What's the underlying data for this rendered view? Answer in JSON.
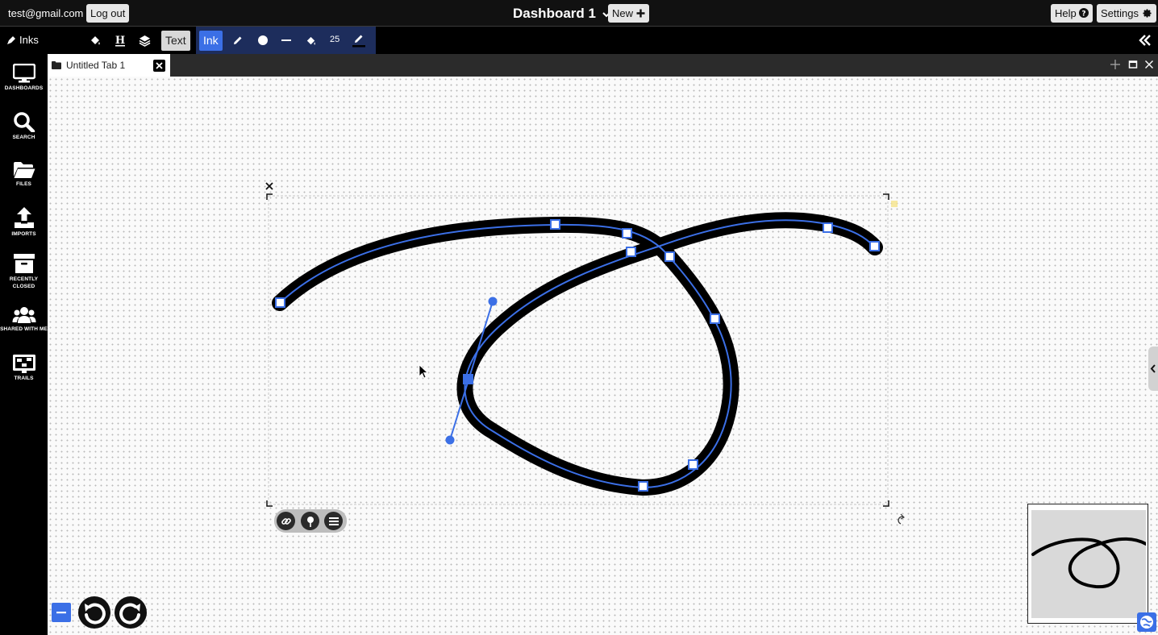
{
  "header": {
    "user_email": "test@gmail.com",
    "logout_label": "Log out",
    "dashboard_title": "Dashboard 1",
    "new_label": "New",
    "help_label": "Help",
    "settings_label": "Settings"
  },
  "toolbar": {
    "context_label": "Inks",
    "text_toggle": "Text",
    "ink_toggle": "Ink",
    "ink_width": "25"
  },
  "sidebar": {
    "items": [
      {
        "label": "DASHBOARDS",
        "icon": "monitor-icon"
      },
      {
        "label": "SEARCH",
        "icon": "search-icon"
      },
      {
        "label": "FILES",
        "icon": "folder-icon"
      },
      {
        "label": "IMPORTS",
        "icon": "upload-icon"
      },
      {
        "label_line1": "RECENTLY",
        "label_line2": "CLOSED",
        "icon": "archive-icon"
      },
      {
        "label": "SHARED WITH ME",
        "icon": "users-icon"
      },
      {
        "label": "TRAILS",
        "icon": "trails-icon"
      }
    ]
  },
  "tabs": [
    {
      "label": "Untitled Tab 1",
      "active": true
    }
  ],
  "colors": {
    "accent": "#3b6fe6",
    "ink_stroke": "#000000",
    "selection_path": "#3b6fe6"
  }
}
